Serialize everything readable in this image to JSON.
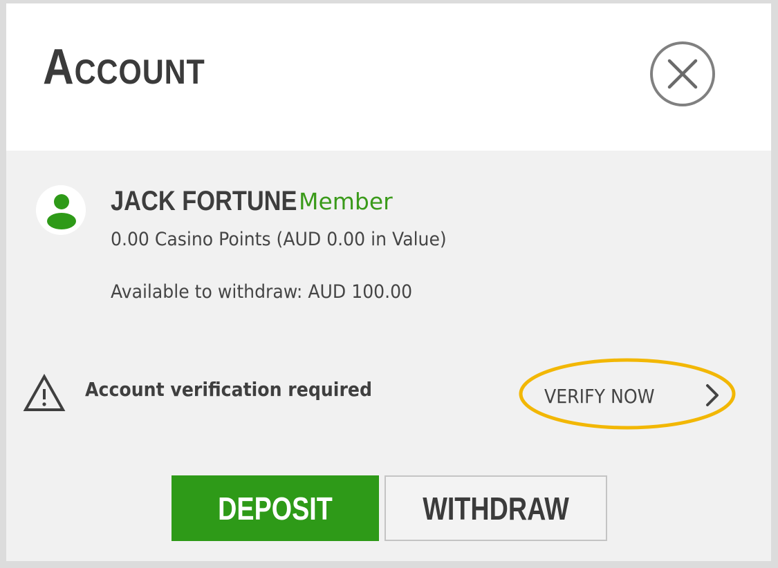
{
  "header": {
    "title": "Account",
    "close_icon": "close-icon"
  },
  "user": {
    "avatar_icon": "user-avatar-icon",
    "name": "JACK FORTUNE",
    "tier": "Member",
    "points_line": "0.00 Casino Points (AUD 0.00 in Value)",
    "withdrawable_line": "Available to withdraw: AUD 100.00"
  },
  "verification": {
    "warning_icon": "warning-icon",
    "message": "Account verification required",
    "link_label": "VERIFY NOW",
    "chevron_icon": "chevron-right-icon",
    "highlight_color": "#f2b705"
  },
  "actions": {
    "deposit_label": "DEPOSIT",
    "withdraw_label": "WITHDRAW"
  },
  "colors": {
    "accent_green": "#2e9a18",
    "member_green": "#3a9a1a",
    "text_dark": "#3b3b3b",
    "panel_bg": "#f1f1f1",
    "header_bg": "#ffffff"
  }
}
